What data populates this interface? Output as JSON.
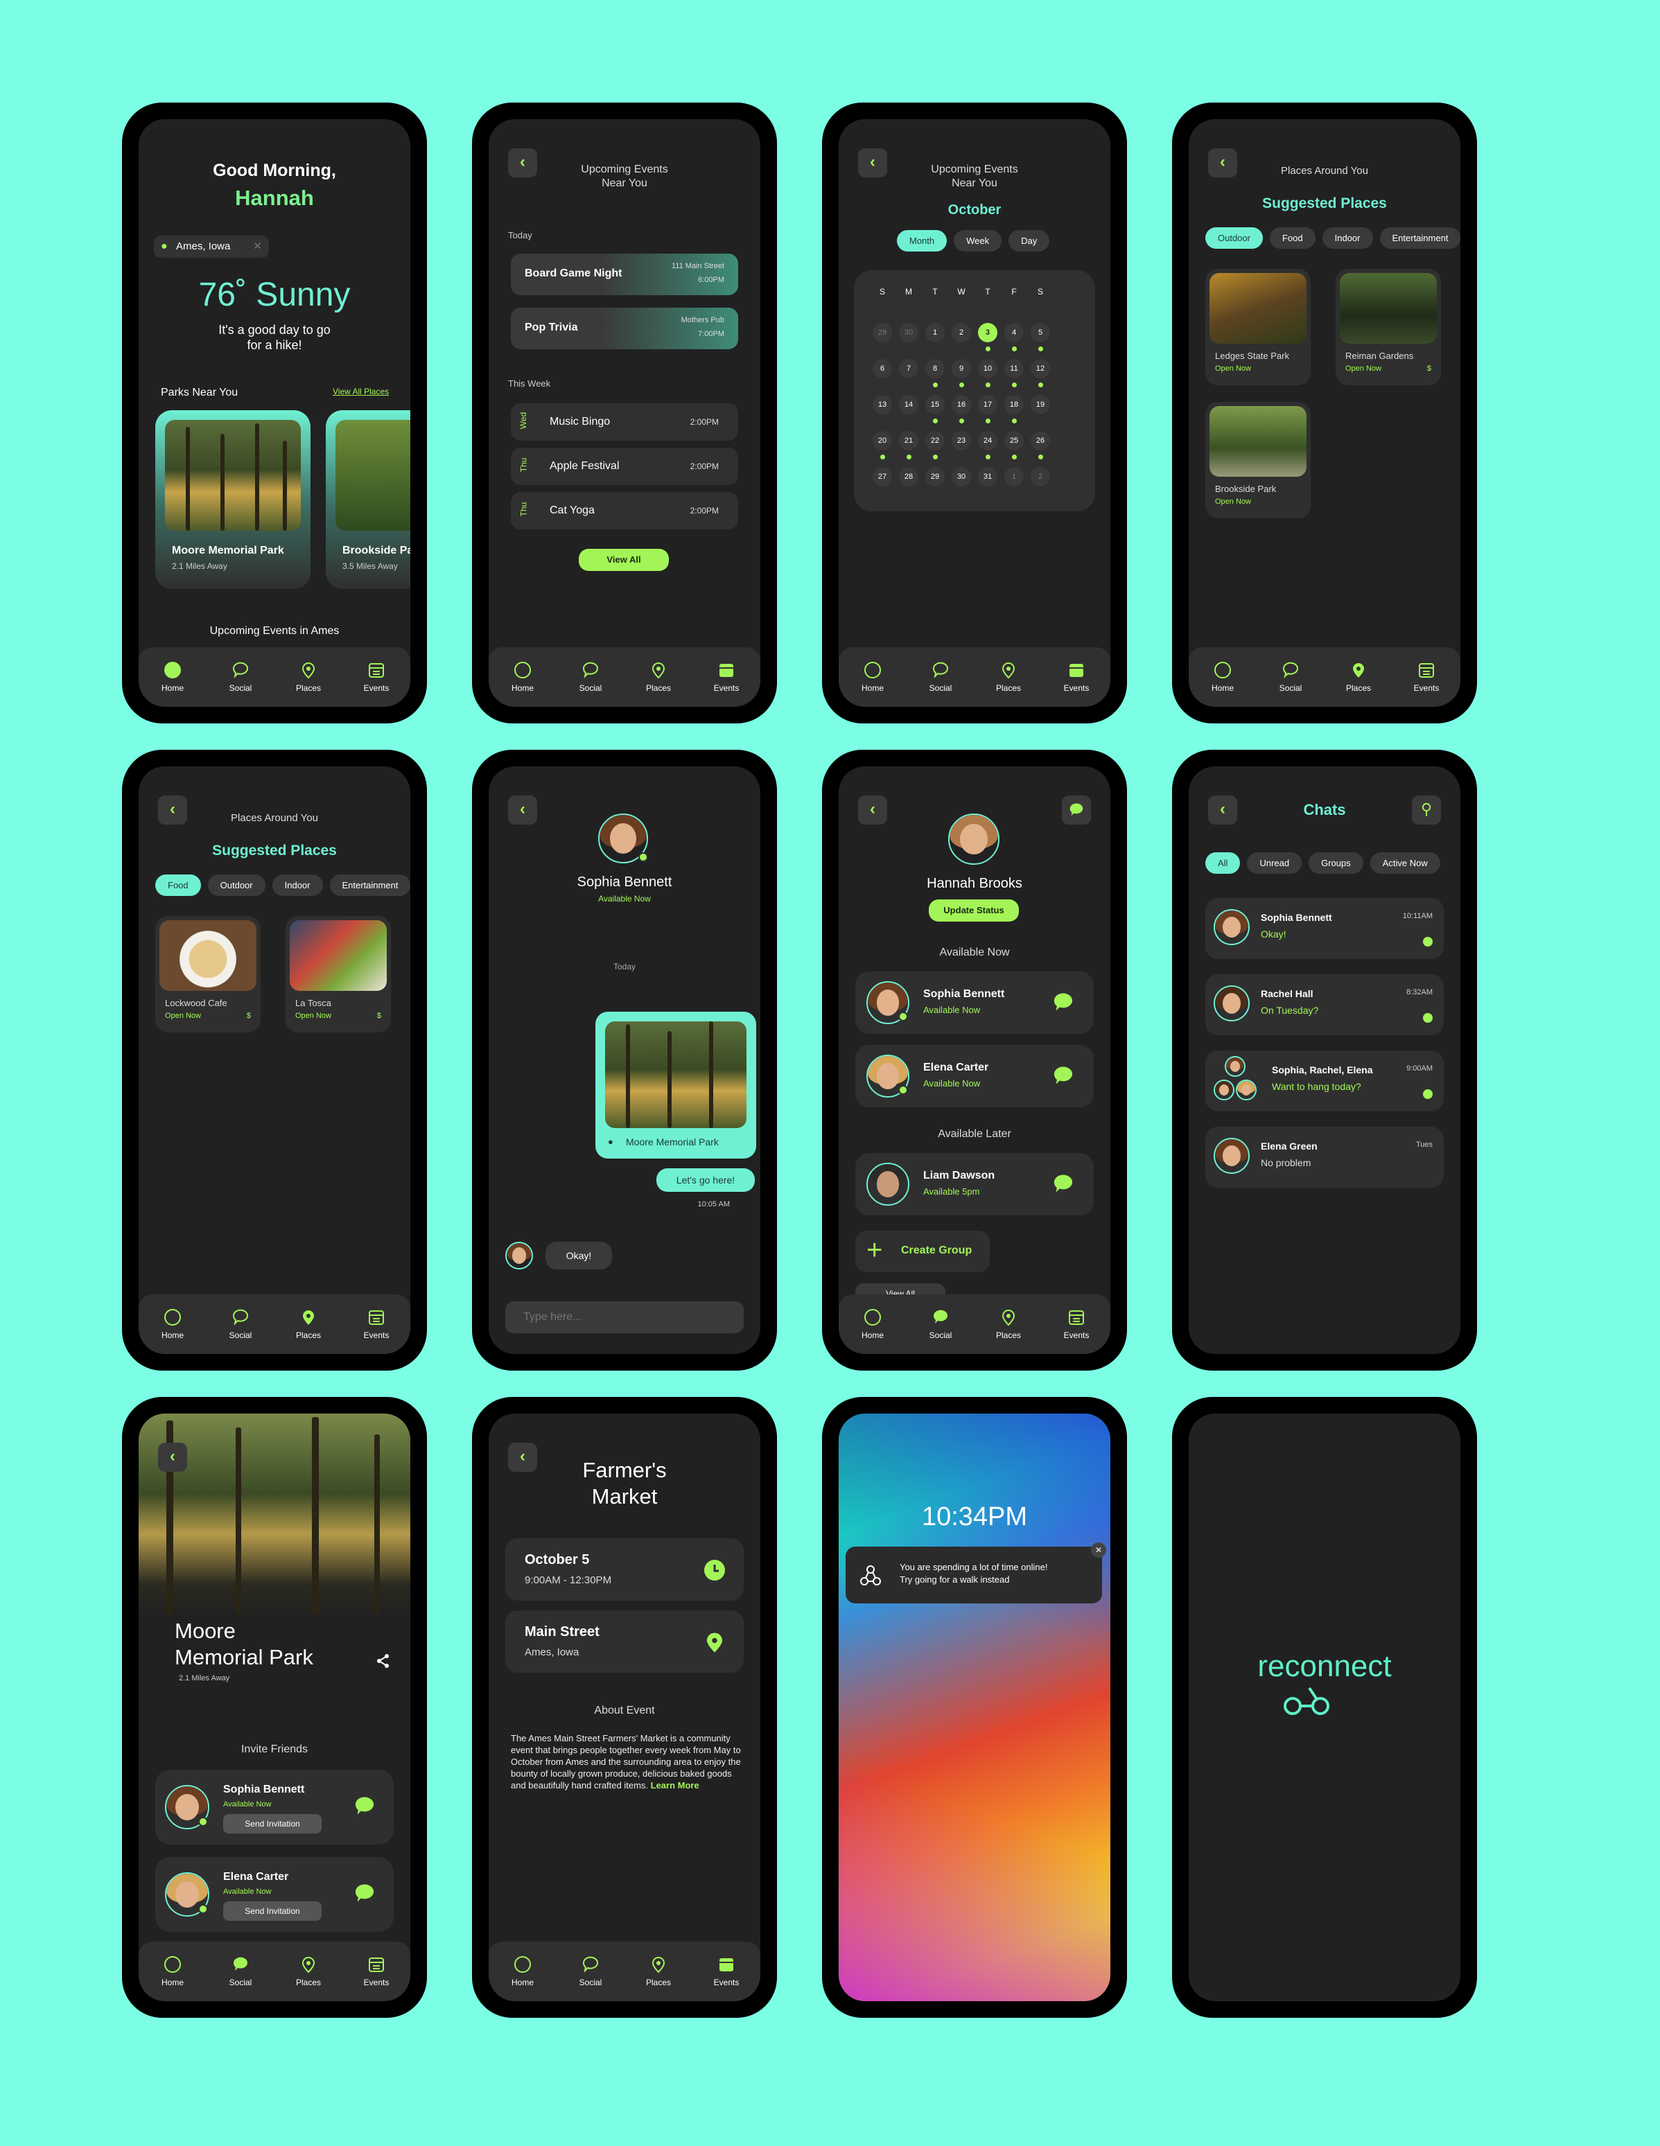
{
  "p1": {
    "greeting": "Good Morning,",
    "name": "Hannah",
    "location": "Ames, Iowa",
    "weather": "76˚ Sunny",
    "tip1": "It's a good day to go",
    "tip2": "for a hike!",
    "section": "Parks Near You",
    "view_all": "View All Places",
    "park1": {
      "name": "Moore Memorial Park",
      "dist": "2.1 Miles Away"
    },
    "park2": {
      "name": "Brookside Park",
      "dist": "3.5 Miles Away"
    },
    "upcoming": "Upcoming Events in Ames"
  },
  "nav": {
    "home": "Home",
    "social": "Social",
    "places": "Places",
    "events": "Events"
  },
  "p2": {
    "title1": "Upcoming Events",
    "title2": "Near You",
    "today": "Today",
    "ev1": {
      "name": "Board Game Night",
      "loc": "111 Main Street",
      "time": "6:00PM"
    },
    "ev2": {
      "name": "Pop Trivia",
      "loc": "Mothers Pub",
      "time": "7:00PM"
    },
    "week": "This Week",
    "w": [
      {
        "day": "Wed",
        "name": "Music Bingo",
        "time": "2:00PM"
      },
      {
        "day": "Thu",
        "name": "Apple Festival",
        "time": "2:00PM"
      },
      {
        "day": "Thu",
        "name": "Cat Yoga",
        "time": "2:00PM"
      }
    ],
    "view_all": "View All"
  },
  "p3": {
    "title1": "Upcoming Events",
    "title2": "Near You",
    "month": "October",
    "tabs": [
      "Month",
      "Week",
      "Day"
    ],
    "dow": [
      "S",
      "M",
      "T",
      "W",
      "T",
      "F",
      "S"
    ]
  },
  "p4": {
    "title": "Places Around You",
    "sub": "Suggested Places",
    "chips": [
      "Outdoor",
      "Food",
      "Indoor",
      "Entertainment"
    ],
    "places": [
      {
        "name": "Ledges State Park",
        "status": "Open Now",
        "price": ""
      },
      {
        "name": "Reiman Gardens",
        "status": "Open Now",
        "price": "$"
      },
      {
        "name": "Brookside Park",
        "status": "Open Now",
        "price": ""
      }
    ]
  },
  "p5": {
    "title": "Places Around You",
    "sub": "Suggested Places",
    "chips": [
      "Food",
      "Outdoor",
      "Indoor",
      "Entertainment"
    ],
    "places": [
      {
        "name": "Lockwood Cafe",
        "status": "Open Now",
        "price": "$"
      },
      {
        "name": "La Tosca",
        "status": "Open Now",
        "price": "$"
      }
    ]
  },
  "p6": {
    "name": "Sophia Bennett",
    "status": "Available Now",
    "today": "Today",
    "place": "Moore Memorial Park",
    "msg": "Let's go here!",
    "time": "10:05 AM",
    "reply": "Okay!",
    "placeholder": "Type here..."
  },
  "p7": {
    "name": "Hannah Brooks",
    "update": "Update Status",
    "avail": "Available Now",
    "later": "Available Later",
    "f1": {
      "name": "Sophia Bennett",
      "status": "Available Now"
    },
    "f2": {
      "name": "Elena Carter",
      "status": "Available Now"
    },
    "f3": {
      "name": "Liam Dawson",
      "status": "Available 5pm"
    },
    "create": "Create Group",
    "view_all": "View All"
  },
  "p8": {
    "title": "Chats",
    "chips": [
      "All",
      "Unread",
      "Groups",
      "Active Now"
    ],
    "chats": [
      {
        "name": "Sophia Bennett",
        "time": "10:11AM",
        "msg": "Okay!"
      },
      {
        "name": "Rachel Hall",
        "time": "8:32AM",
        "msg": "On Tuesday?"
      },
      {
        "name": "Sophia, Rachel, Elena",
        "time": "9:00AM",
        "msg": "Want to hang today?"
      },
      {
        "name": "Elena Green",
        "time": "Tues",
        "msg": "No problem"
      }
    ]
  },
  "p9": {
    "name1": "Moore",
    "name2": "Memorial Park",
    "dist": "2.1 Miles Away",
    "invite": "Invite Friends",
    "f1": {
      "name": "Sophia Bennett",
      "status": "Available Now"
    },
    "f2": {
      "name": "Elena Carter",
      "status": "Available Now"
    },
    "send": "Send Invitation"
  },
  "p10": {
    "t1": "Farmer's",
    "t2": "Market",
    "date": "October 5",
    "hours": "9:00AM - 12:30PM",
    "street": "Main Street",
    "city": "Ames, Iowa",
    "about": "About Event",
    "desc": "The Ames Main Street Farmers' Market is a community event that brings people together every week from May to October from Ames and the surrounding area to enjoy the bounty of locally grown produce, delicious baked goods and beautifully hand crafted items.",
    "more": "Learn More"
  },
  "p11": {
    "time": "10:34PM",
    "n1": "You are spending a lot of time online!",
    "n2": "Try going for a walk instead"
  },
  "p12": {
    "logo": "reconnect"
  },
  "colors": {
    "bg": "#7bfee4",
    "green": "#a3f557",
    "teal": "#6ff0d3",
    "screen": "#212121"
  }
}
